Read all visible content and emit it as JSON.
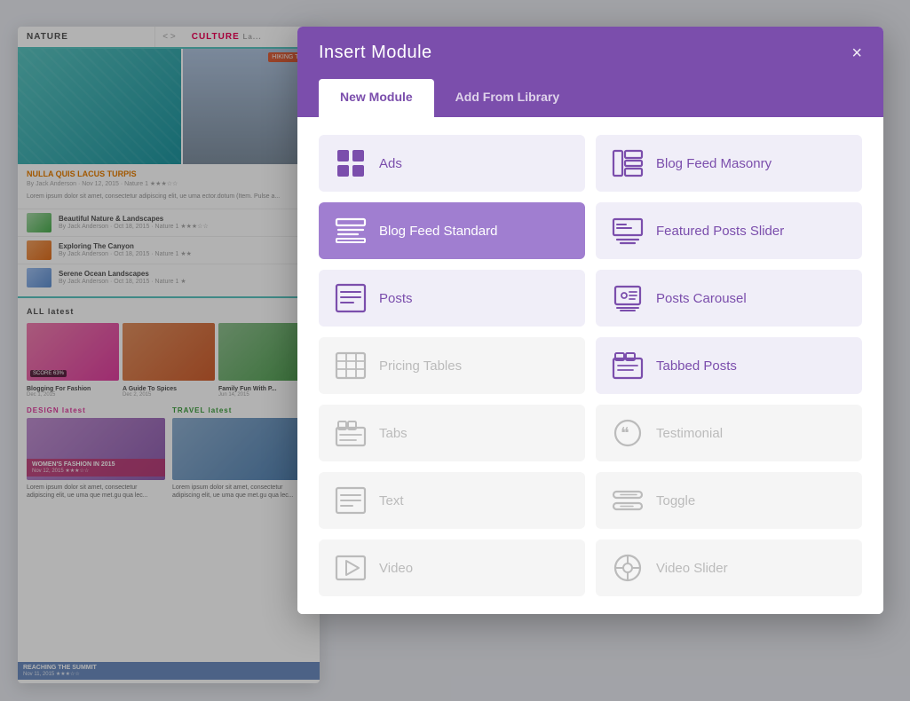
{
  "modal": {
    "title": "Insert Module",
    "close_label": "×",
    "tabs": [
      {
        "id": "new-module",
        "label": "New Module",
        "active": true
      },
      {
        "id": "add-from-library",
        "label": "Add From Library",
        "active": false
      }
    ],
    "modules": [
      {
        "id": "ads",
        "label": "Ads",
        "icon": "ads",
        "state": "default"
      },
      {
        "id": "blog-feed-masonry",
        "label": "Blog Feed Masonry",
        "icon": "blog-feed-masonry",
        "state": "default"
      },
      {
        "id": "blog-feed-standard",
        "label": "Blog Feed Standard",
        "icon": "blog-feed-standard",
        "state": "active"
      },
      {
        "id": "featured-posts-slider",
        "label": "Featured Posts Slider",
        "icon": "featured-posts-slider",
        "state": "default"
      },
      {
        "id": "posts",
        "label": "Posts",
        "icon": "posts",
        "state": "default"
      },
      {
        "id": "posts-carousel",
        "label": "Posts Carousel",
        "icon": "posts-carousel",
        "state": "default"
      },
      {
        "id": "pricing-tables",
        "label": "Pricing Tables",
        "icon": "pricing-tables",
        "state": "inactive"
      },
      {
        "id": "tabbed-posts",
        "label": "Tabbed Posts",
        "icon": "tabbed-posts",
        "state": "default"
      },
      {
        "id": "tabs",
        "label": "Tabs",
        "icon": "tabs",
        "state": "inactive"
      },
      {
        "id": "testimonial",
        "label": "Testimonial",
        "icon": "testimonial",
        "state": "inactive"
      },
      {
        "id": "text",
        "label": "Text",
        "icon": "text",
        "state": "inactive"
      },
      {
        "id": "toggle",
        "label": "Toggle",
        "icon": "toggle",
        "state": "inactive"
      },
      {
        "id": "video",
        "label": "Video",
        "icon": "video",
        "state": "inactive"
      },
      {
        "id": "video-slider",
        "label": "Video Slider",
        "icon": "video-slider",
        "state": "inactive"
      }
    ]
  },
  "blog": {
    "sections": [
      "NATURE",
      "CULTURE"
    ],
    "article_title": "NULLA QUIS LACUS TURPIS",
    "list_items": [
      {
        "title": "Beautiful Nature & Landscapes"
      },
      {
        "title": "Exploring The Canyon"
      },
      {
        "title": "Serene Ocean Landscapes"
      }
    ],
    "tag_all": "ALL latest",
    "grid_items": [
      {
        "title": "Blogging For Fashion",
        "date": "Dec 1, 2015"
      },
      {
        "title": "A Guide To Spices",
        "date": "Dec 2, 2015"
      },
      {
        "title": "Family Fun With...",
        "date": "Jun 14, 2015"
      }
    ],
    "section2_labels": [
      "DESIGN latest",
      "TRAVEL latest"
    ],
    "big_article1": "WOMEN'S FASHION IN 2015",
    "big_article2": "REACHING THE SUMMIT"
  }
}
